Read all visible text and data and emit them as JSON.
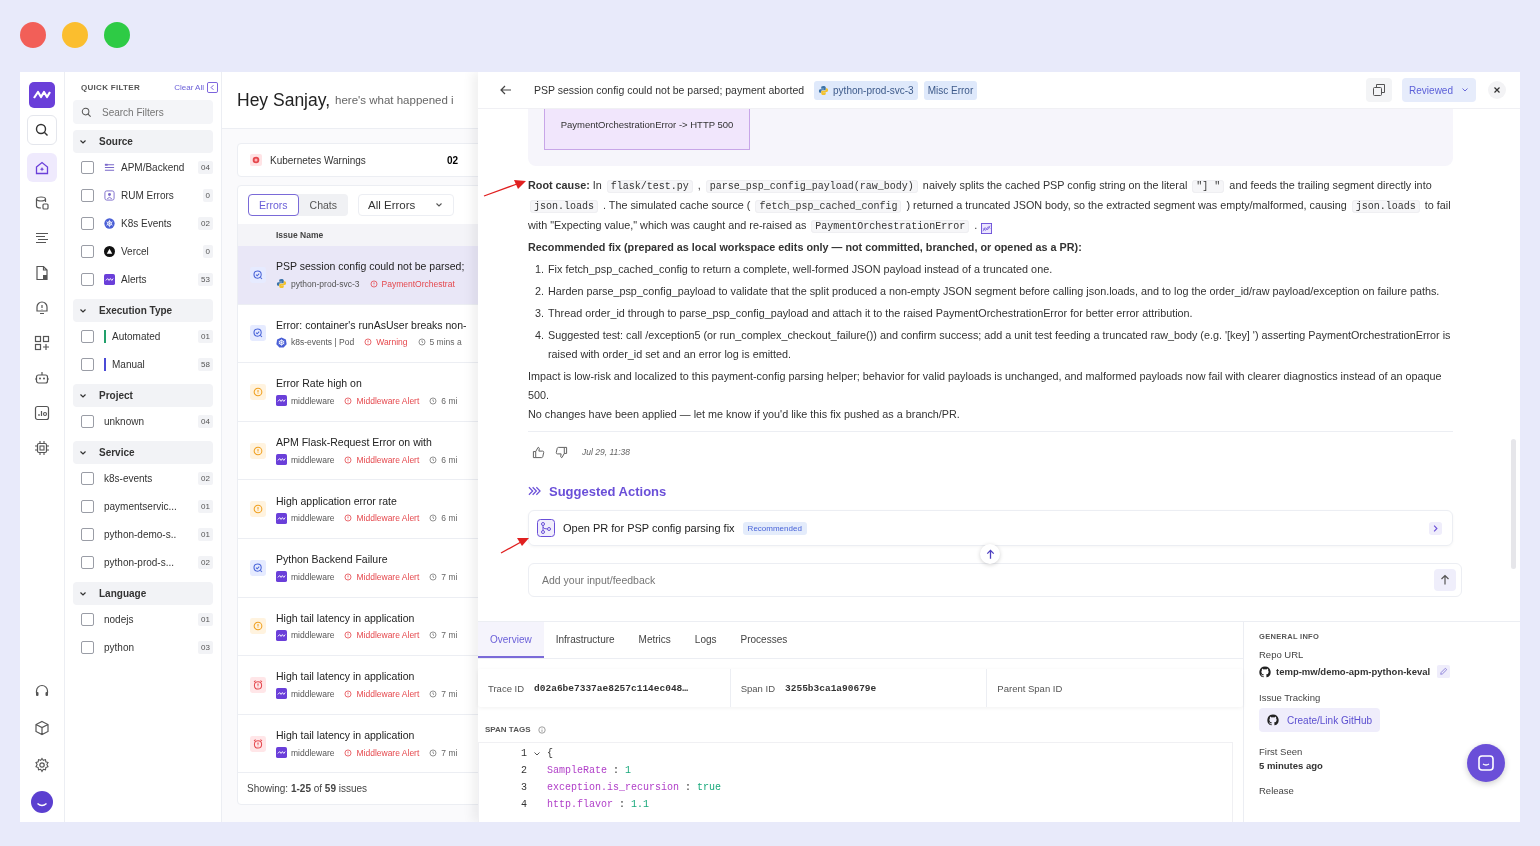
{
  "window_controls": [
    {
      "color": "#f25f58"
    },
    {
      "color": "#fbbe2e"
    },
    {
      "color": "#2ecb45"
    }
  ],
  "nav_rail": {
    "top": [
      {
        "kind": "logo",
        "selected": false
      },
      {
        "kind": "search",
        "selected": false
      },
      {
        "kind": "ai",
        "selected": true
      },
      {
        "kind": "database",
        "selected": false
      },
      {
        "kind": "list",
        "selected": false
      },
      {
        "kind": "document",
        "selected": false
      },
      {
        "kind": "bell",
        "selected": false
      },
      {
        "kind": "dashboard",
        "selected": false
      },
      {
        "kind": "robot",
        "selected": false
      },
      {
        "kind": "user-chart",
        "selected": false
      },
      {
        "kind": "chip",
        "selected": false
      }
    ],
    "bottom": [
      {
        "kind": "headset",
        "selected": false
      },
      {
        "kind": "cube",
        "selected": false
      },
      {
        "kind": "gear",
        "selected": false
      },
      {
        "kind": "avatar",
        "selected": false
      }
    ]
  },
  "quick_filter": {
    "title": "QUICK FILTER",
    "clear": "Clear All",
    "search": {
      "placeholder": "Search Filters"
    },
    "groups": [
      {
        "title": "Source",
        "expanded": true,
        "items": [
          {
            "label": "APM/Backend",
            "count": "04",
            "checked": false,
            "kind": "apm"
          },
          {
            "label": "RUM Errors",
            "count": "0",
            "checked": false,
            "kind": "rum"
          },
          {
            "label": "K8s Events",
            "count": "02",
            "checked": false,
            "kind": "k8s"
          },
          {
            "label": "Vercel",
            "count": "0",
            "checked": false,
            "kind": "vercel"
          },
          {
            "label": "Alerts",
            "count": "53",
            "checked": false,
            "kind": "alerts"
          }
        ]
      },
      {
        "title": "Execution Type",
        "expanded": true,
        "items": [
          {
            "label": "Automated",
            "count": "01",
            "checked": false,
            "color": "#22a06b"
          },
          {
            "label": "Manual",
            "count": "58",
            "checked": false,
            "color": "#4b4bd6"
          }
        ]
      },
      {
        "title": "Project",
        "expanded": true,
        "items": [
          {
            "label": "unknown",
            "count": "04",
            "checked": false
          }
        ]
      },
      {
        "title": "Service",
        "expanded": true,
        "items": [
          {
            "label": "k8s-events",
            "count": "02",
            "checked": false
          },
          {
            "label": "paymentservic...",
            "count": "01",
            "checked": false
          },
          {
            "label": "python-demo-s..",
            "count": "01",
            "checked": false
          },
          {
            "label": "python-prod-s...",
            "count": "02",
            "checked": false
          }
        ]
      },
      {
        "title": "Language",
        "expanded": true,
        "items": [
          {
            "label": "nodejs",
            "count": "01",
            "checked": false
          },
          {
            "label": "python",
            "count": "03",
            "checked": false
          }
        ]
      }
    ]
  },
  "issues_panel": {
    "greeting": "Hey Sanjay,",
    "greeting_sub": "here's what happened i",
    "warning_card": {
      "label": "Kubernetes Warnings",
      "count": "02"
    },
    "tabs": [
      {
        "label": "Errors",
        "selected": true
      },
      {
        "label": "Chats",
        "selected": false
      }
    ],
    "filter_dropdown": "All Errors",
    "column": "Issue Name",
    "rows": [
      {
        "title": "PSP session config could not be parsed;",
        "kind": "investigate",
        "source": {
          "kind": "python",
          "label": "python-prod-svc-3"
        },
        "tag": "PaymentOrchestrat",
        "selected": true
      },
      {
        "title": "Error: container's runAsUser breaks non-",
        "kind": "investigate",
        "source": {
          "kind": "k8s",
          "label": "k8s-events | Pod"
        },
        "tag": "Warning",
        "time": "5 mins a",
        "selected": false
      },
      {
        "title": "Error Rate high on",
        "kind": "warning",
        "source": {
          "kind": "middleware",
          "label": "middleware"
        },
        "tag": "Middleware Alert",
        "time": "6 mi",
        "selected": false
      },
      {
        "title": "APM Flask-Request Error on with",
        "kind": "warning",
        "source": {
          "kind": "middleware",
          "label": "middleware"
        },
        "tag": "Middleware Alert",
        "time": "6 mi",
        "selected": false
      },
      {
        "title": "High application error rate",
        "kind": "warning",
        "source": {
          "kind": "middleware",
          "label": "middleware"
        },
        "tag": "Middleware Alert",
        "time": "6 mi",
        "selected": false
      },
      {
        "title": "Python Backend Failure",
        "kind": "investigate",
        "source": {
          "kind": "middleware",
          "label": "middleware"
        },
        "tag": "Middleware Alert",
        "time": "7 mi",
        "selected": false
      },
      {
        "title": "High tail latency in application",
        "kind": "warning",
        "source": {
          "kind": "middleware",
          "label": "middleware"
        },
        "tag": "Middleware Alert",
        "time": "7 mi",
        "selected": false
      },
      {
        "title": "High tail latency in application",
        "kind": "critical",
        "source": {
          "kind": "middleware",
          "label": "middleware"
        },
        "tag": "Middleware Alert",
        "time": "7 mi",
        "selected": false
      },
      {
        "title": "High tail latency in application",
        "kind": "critical",
        "source": {
          "kind": "middleware",
          "label": "middleware"
        },
        "tag": "Middleware Alert",
        "time": "7 mi",
        "selected": false
      }
    ],
    "footer": "Showing: **1-25** of **59** issues"
  },
  "detail": {
    "title": "PSP session config could not be parsed; payment aborted",
    "tags": [
      {
        "label": "python-prod-svc-3",
        "kind": "service"
      },
      {
        "label": "Misc Error",
        "kind": "type"
      }
    ],
    "status": "Reviewed",
    "diagram_node": "PaymentOrchestrationError -> HTTP 500",
    "root_cause": [
      {
        "kind": "bold",
        "text": "Root cause:"
      },
      {
        "kind": "text",
        "text": " In "
      },
      {
        "kind": "code",
        "text": "flask/test.py"
      },
      {
        "kind": "text",
        "text": " , "
      },
      {
        "kind": "code",
        "text": "parse_psp_config_payload(raw_body)"
      },
      {
        "kind": "text",
        "text": " naively splits the cached PSP config string on the literal "
      },
      {
        "kind": "code",
        "text": "\"] \""
      },
      {
        "kind": "text",
        "text": " and feeds the trailing segment directly into "
      },
      {
        "kind": "code",
        "text": "json.loads"
      },
      {
        "kind": "text",
        "text": " . The simulated cache source ( "
      },
      {
        "kind": "code",
        "text": "fetch_psp_cached_config"
      },
      {
        "kind": "text",
        "text": " ) returned a truncated JSON body, so the extracted segment was empty/malformed, causing "
      },
      {
        "kind": "code",
        "text": "json.loads"
      },
      {
        "kind": "text",
        "text": " to fail with \"Expecting value,\" which was caught and re-raised as "
      },
      {
        "kind": "code",
        "text": "PaymentOrchestrationError"
      },
      {
        "kind": "text",
        "text": " ."
      }
    ],
    "fix_heading": "Recommended fix (prepared as local workspace edits only — not committed, branched, or opened as a PR):",
    "fix_steps": [
      {
        "number": "1.",
        "text": "Fix fetch_psp_cached_config to return a complete, well-formed JSON payload instead of a truncated one."
      },
      {
        "number": "2.",
        "text": "Harden parse_psp_config_payload to validate that the split produced a non-empty JSON segment before calling json.loads, and to log the order_id/raw payload/exception on failure paths."
      },
      {
        "number": "3.",
        "text": "Thread order_id through to parse_psp_config_payload and attach it to the raised PaymentOrchestrationError for better error attribution."
      },
      {
        "number": "4.",
        "text": "Suggested test: call /exception5 (or run_complex_checkout_failure()) and confirm success; add a unit test feeding a truncated raw_body (e.g. '[key] ') asserting PaymentOrchestrationError is raised with order_id set and an error log is emitted."
      }
    ],
    "impact": "Impact is low-risk and localized to this payment-config parsing helper; behavior for valid payloads is unchanged, and malformed payloads now fail with clearer diagnostics instead of an opaque 500.",
    "closing": "No changes have been applied — let me know if you'd like this fix pushed as a branch/PR.",
    "timestamp": "Jul 29, 11:38",
    "suggested_title": "Suggested Actions",
    "actions": [
      {
        "label": "Open PR for PSP config parsing fix",
        "badge": "Recommended"
      }
    ],
    "input": {
      "placeholder": "Add your input/feedback"
    },
    "tabs": [
      {
        "label": "Overview",
        "selected": true
      },
      {
        "label": "Infrastructure",
        "selected": false
      },
      {
        "label": "Metrics",
        "selected": false
      },
      {
        "label": "Logs",
        "selected": false
      },
      {
        "label": "Processes",
        "selected": false
      }
    ],
    "ids": [
      {
        "label": "Trace ID",
        "value": "d02a6be7337ae8257c114ec048…"
      },
      {
        "label": "Span ID",
        "value": "3255b3ca1a90679e"
      },
      {
        "label": "Parent Span ID"
      }
    ],
    "span_tags": {
      "title": "SPAN TAGS",
      "lines": [
        {
          "number": "1",
          "text": "{"
        },
        {
          "number": "2",
          "key": "SampleRate",
          "separator": ":",
          "value": "1"
        },
        {
          "number": "3",
          "key": "exception.is_recursion",
          "separator": ":",
          "value": "true"
        },
        {
          "number": "4",
          "key": "http.flavor",
          "separator": ":",
          "value": "1.1"
        }
      ]
    },
    "general_info": {
      "title": "GENERAL INFO",
      "repo_label": "Repo URL",
      "repo": "temp-mw/demo-apm-python-keval",
      "tracking_label": "Issue Tracking",
      "tracking_button": "Create/Link GitHub",
      "first_seen_label": "First Seen",
      "first_seen": "5 minutes ago",
      "release_label": "Release"
    }
  }
}
